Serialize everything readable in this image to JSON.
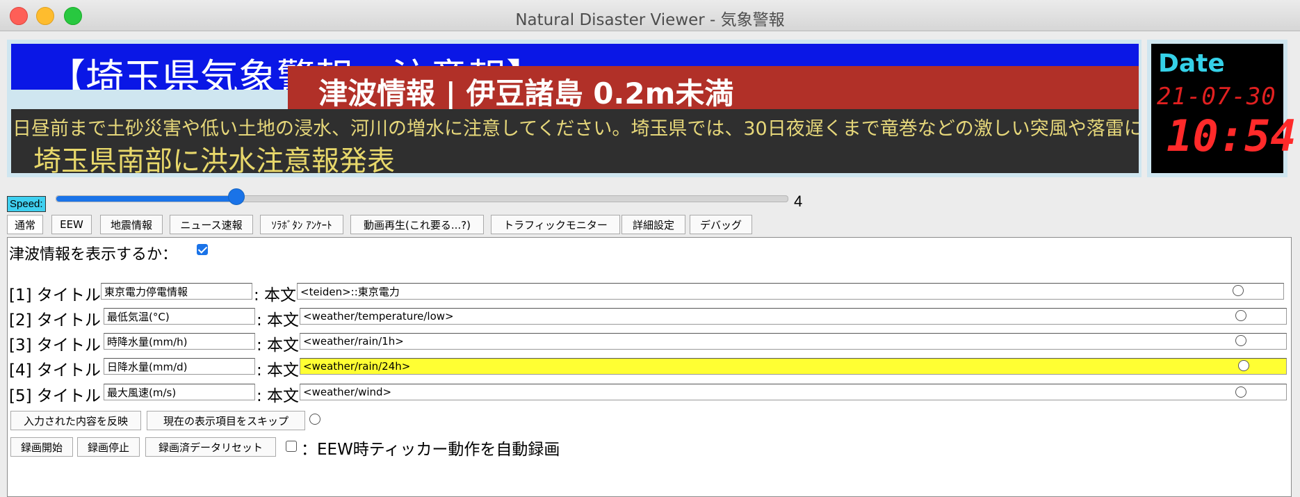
{
  "window": {
    "title": "Natural Disaster Viewer - 気象警報"
  },
  "ticker": {
    "headline": "【埼玉県気象警報・注意報】",
    "tsunami_banner": "津波情報 | 伊豆諸島 0.2m未満",
    "scroll_text": "日昼前まで土砂災害や低い土地の浸水、河川の増水に注意してください。埼玉県では、30日夜遅くまで竜巻などの激しい突風や落雷に注意し",
    "flood_text": "埼玉県南部に洪水注意報発表"
  },
  "clock": {
    "label": "Date",
    "date": "21-07-30",
    "time": "10:54"
  },
  "speed": {
    "label": "Speed:",
    "value": "4",
    "level_fraction": 0.245
  },
  "tabs": [
    "通常",
    "EEW",
    "地震情報",
    "ニュース速報",
    "ｿﾗﾎﾞﾀﾝ ｱﾝｹｰﾄ",
    "動画再生(これ要る...?)",
    "トラフィックモニター",
    "詳細設定",
    "デバッグ"
  ],
  "panel": {
    "show_tsunami_label": "津波情報を表示するか：",
    "show_tsunami_checked": true,
    "rows": [
      {
        "index": "[1] タイトル",
        "title": "東京電力停電情報",
        "sep": ": 本文",
        "body": "<teiden>::東京電力",
        "highlight": false
      },
      {
        "index": "[2] タイトル",
        "title": "最低気温(°C)",
        "sep": ": 本文",
        "body": "<weather/temperature/low>",
        "highlight": false
      },
      {
        "index": "[3] タイトル",
        "title": "時降水量(mm/h)",
        "sep": ": 本文",
        "body": "<weather/rain/1h>",
        "highlight": false
      },
      {
        "index": "[4] タイトル",
        "title": "日降水量(mm/d)",
        "sep": ": 本文",
        "body": "<weather/rain/24h>",
        "highlight": true
      },
      {
        "index": "[5] タイトル",
        "title": "最大風速(m/s)",
        "sep": ": 本文",
        "body": "<weather/wind>",
        "highlight": false
      }
    ],
    "apply_button": "入力された内容を反映",
    "skip_button": "現在の表示項目をスキップ",
    "rec_start": "録画開始",
    "rec_stop": "録画停止",
    "rec_reset": "録画済データリセット",
    "auto_record_label": "：EEW時ティッカー動作を自動録画",
    "auto_record_checked": false
  },
  "colors": {
    "accent": "#1a73e8",
    "ticker_blue": "#0a17e6",
    "ticker_red": "#b13028",
    "highlight": "#ffff33"
  }
}
